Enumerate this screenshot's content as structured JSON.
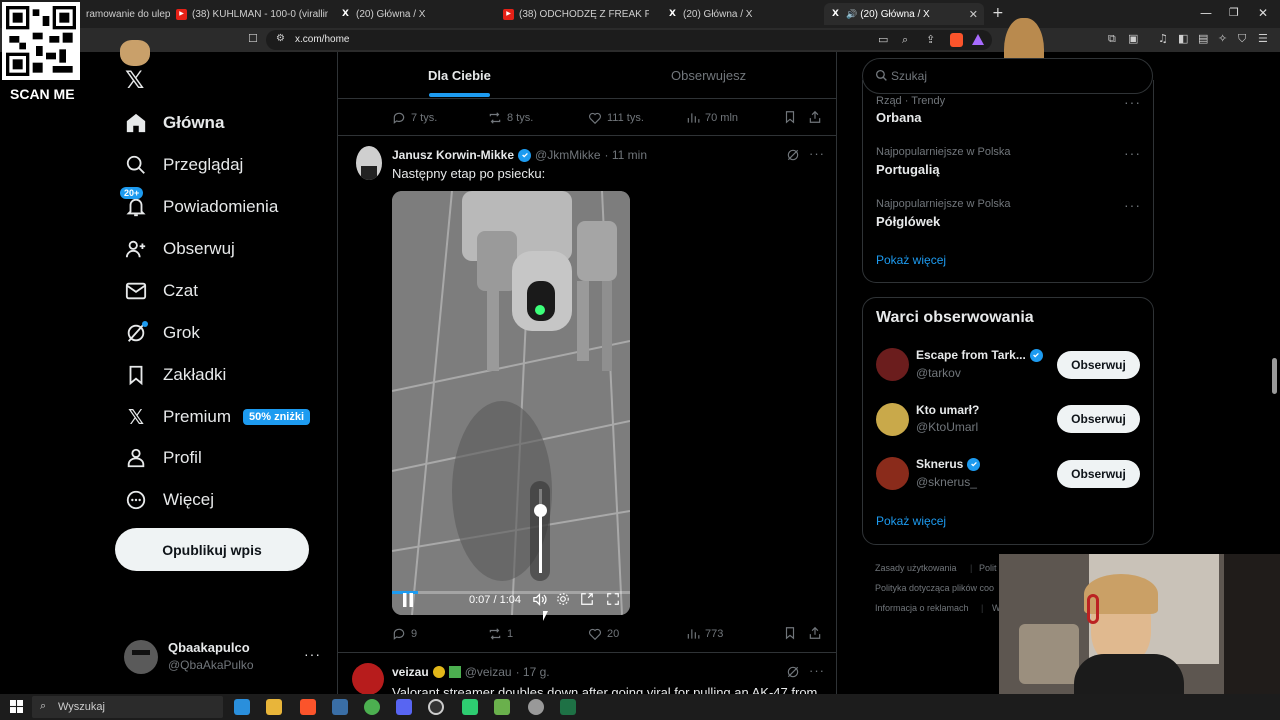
{
  "browser": {
    "tabs": [
      {
        "title": "ramowanie do ulep",
        "icon": "yt-icon"
      },
      {
        "title": "(38) KUHLMAN - 100-0 (virallinen m",
        "icon": "yt-icon"
      },
      {
        "title": "(20) Główna / X",
        "icon": "x-icon"
      },
      {
        "title": "(38) ODCHODZĘ Z FREAK FIGHTÓW |",
        "icon": "yt-icon"
      },
      {
        "title": "(20) Główna / X",
        "icon": "x-icon"
      },
      {
        "title": "(20) Główna / X",
        "icon": "x-icon",
        "active": true
      }
    ],
    "url": "x.com/home"
  },
  "overlay": {
    "qr_label": "SCAN ME"
  },
  "nav": {
    "items": [
      {
        "label": "Główna",
        "icon": "home-icon",
        "bold": true
      },
      {
        "label": "Przeglądaj",
        "icon": "search-icon"
      },
      {
        "label": "Powiadomienia",
        "icon": "bell-icon",
        "badge": "20+"
      },
      {
        "label": "Obserwuj",
        "icon": "follow-icon"
      },
      {
        "label": "Czat",
        "icon": "mail-icon"
      },
      {
        "label": "Grok",
        "icon": "grok-icon"
      },
      {
        "label": "Zakładki",
        "icon": "bookmark-icon"
      },
      {
        "label": "Premium",
        "icon": "x-logo-icon",
        "badge": "50% zniżki"
      },
      {
        "label": "Profil",
        "icon": "person-icon"
      },
      {
        "label": "Więcej",
        "icon": "more-icon"
      }
    ],
    "post_button": "Opublikuj wpis",
    "account": {
      "name": "Qbaakapulco",
      "handle": "@QbaAkaPulko"
    }
  },
  "feed": {
    "tabs": [
      "Dla Ciebie",
      "Obserwujesz"
    ],
    "prev_post_stats": {
      "replies": "7 tys.",
      "reposts": "8 tys.",
      "likes": "111 tys.",
      "views": "70 mln"
    },
    "post": {
      "author": "Janusz Korwin-Mikke",
      "handle": "@JkmMikke",
      "time": "· 11 min",
      "text": "Następny etap po psiecku:",
      "video": {
        "time": "0:07 / 1:04",
        "volume": 0.75,
        "progress": 0.11
      },
      "stats": {
        "replies": "9",
        "reposts": "1",
        "likes": "20",
        "views": "773"
      }
    },
    "next_post": {
      "author": "veizau",
      "handle": "@veizau",
      "time": "· 17 g.",
      "text": "Valorant streamer doubles down after going viral for pulling an AK-47 from"
    }
  },
  "sidebar": {
    "search_placeholder": "Szukaj",
    "trends": [
      {
        "meta": "Rząd · Trendy",
        "name": "Orbana"
      },
      {
        "meta": "Najpopularniejsze w Polska",
        "name": "Portugalią"
      },
      {
        "meta": "Najpopularniejsze w Polska",
        "name": "Półglówek"
      }
    ],
    "show_more": "Pokaż więcej",
    "who_to_follow_title": "Warci obserwowania",
    "who_to_follow": [
      {
        "name": "Escape from Tark...",
        "handle": "@tarkov",
        "verified": "gold",
        "avatar_color": "#6b1d1d"
      },
      {
        "name": "Kto umarł?",
        "handle": "@KtoUmarl",
        "verified": "",
        "avatar_color": "#c9a94a"
      },
      {
        "name": "Sknerus",
        "handle": "@sknerus_",
        "verified": "blue",
        "avatar_color": "#8a2b1b"
      }
    ],
    "follow_label": "Obserwuj",
    "show_more2": "Pokaż więcej",
    "footer": [
      "Zasady użytkowania",
      "Polit",
      "Polityka dotycząca plików coo",
      "Informacja o reklamach",
      "W"
    ]
  },
  "taskbar": {
    "search": "Wyszukaj"
  },
  "colors": {
    "accent": "#1d9bf0",
    "background": "#000000",
    "border": "#2f3336"
  }
}
